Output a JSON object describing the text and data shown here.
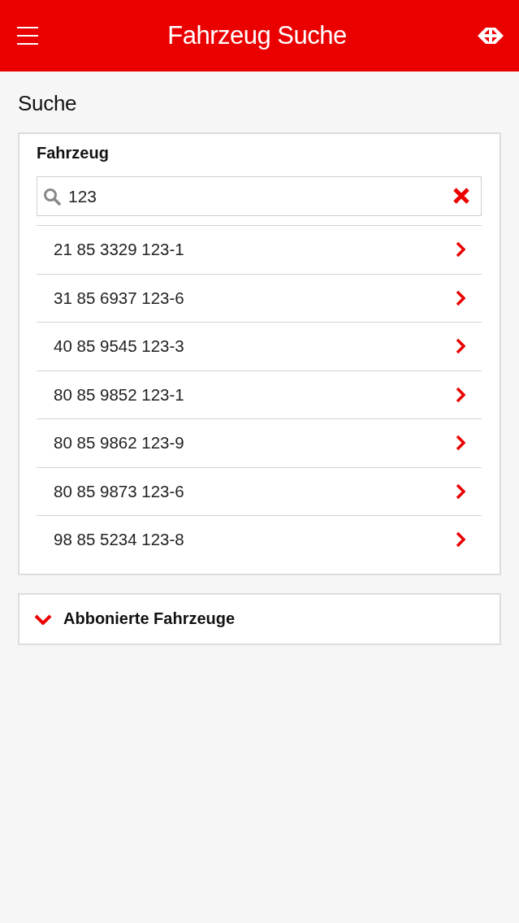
{
  "header": {
    "title": "Fahrzeug Suche"
  },
  "section_title": "Suche",
  "search_card": {
    "label": "Fahrzeug",
    "search": {
      "value": "123"
    },
    "results": [
      {
        "label": "21 85 3329 123-1"
      },
      {
        "label": "31 85 6937 123-6"
      },
      {
        "label": "40 85 9545 123-3"
      },
      {
        "label": "80 85 9852 123-1"
      },
      {
        "label": "80 85 9862 123-9"
      },
      {
        "label": "80 85 9873 123-6"
      },
      {
        "label": "98 85 5234 123-8"
      }
    ]
  },
  "subscribed": {
    "title": "Abbonierte Fahrzeuge",
    "expanded": false
  }
}
